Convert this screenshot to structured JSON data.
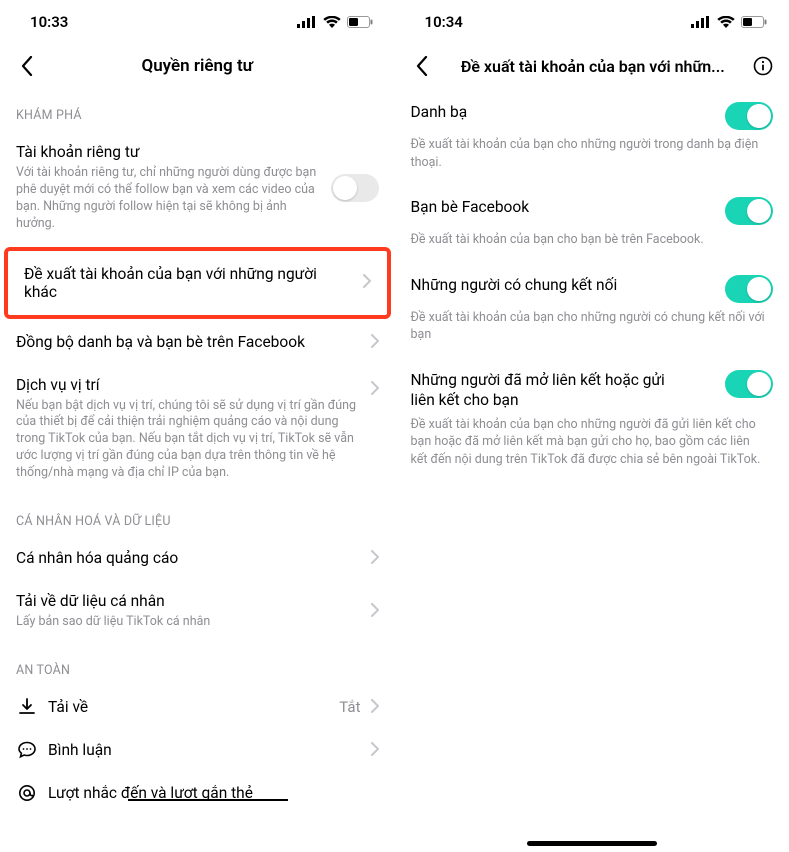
{
  "left": {
    "statusbar": {
      "time": "10:33"
    },
    "header": {
      "title": "Quyền riêng tư"
    },
    "sections": {
      "discover": {
        "title": "KHÁM PHÁ",
        "private_account": {
          "label": "Tài khoản riêng tư",
          "desc": "Với tài khoản riêng tư, chỉ những người dùng được bạn phê duyệt mới có thể follow bạn và xem các video của bạn. Những người follow hiện tại sẽ không bị ảnh hưởng.",
          "on": false
        },
        "suggest_account": {
          "label": "Đề xuất tài khoản của bạn với những người khác"
        },
        "sync_contacts": {
          "label": "Đồng bộ danh bạ và bạn bè trên Facebook"
        },
        "location": {
          "label": "Dịch vụ vị trí",
          "desc": "Nếu bạn bật dịch vụ vị trí, chúng tôi sẽ sử dụng vị trí gần đúng của thiết bị để cải thiện trải nghiệm quảng cáo và nội dung trong TikTok của bạn. Nếu bạn tắt dịch vụ vị trí, TikTok sẽ vẫn ước lượng vị trí gần đúng của bạn dựa trên thông tin về hệ thống/nhà mạng và địa chỉ IP của bạn."
        }
      },
      "personalization": {
        "title": "CÁ NHÂN HOÁ VÀ DỮ LIỆU",
        "ad_personalization": {
          "label": "Cá nhân hóa quảng cáo"
        },
        "download_data": {
          "label": "Tải về dữ liệu cá nhân",
          "desc": "Lấy bản sao dữ liệu TikTok cá nhân"
        }
      },
      "safety": {
        "title": "AN TOÀN",
        "downloads": {
          "label": "Tải về",
          "value": "Tắt"
        },
        "comments": {
          "label": "Bình luận"
        },
        "mentions": {
          "label": "Lượt nhắc đến và lượt gắn thẻ"
        }
      }
    }
  },
  "right": {
    "statusbar": {
      "time": "10:34"
    },
    "header": {
      "title": "Đề xuất tài khoản của bạn với nhữn..."
    },
    "items": {
      "contacts": {
        "label": "Danh bạ",
        "desc": "Đề xuất tài khoản của bạn cho những người trong danh bạ điện thoại.",
        "on": true
      },
      "facebook": {
        "label": "Bạn bè Facebook",
        "desc": "Đề xuất tài khoản của bạn cho bạn bè trên Facebook.",
        "on": true
      },
      "mutual": {
        "label": "Những người có chung kết nối",
        "desc": "Đề xuất tài khoản của bạn cho những người có chung kết nối với bạn",
        "on": true
      },
      "links": {
        "label": "Những người đã mở liên kết hoặc gửi liên kết cho bạn",
        "desc": "Đề xuất tài khoản của bạn cho những người đã gửi liên kết cho bạn hoặc đã mở liên kết mà bạn gửi cho họ, bao gồm các liên kết đến nội dung trên TikTok đã được chia sẻ bên ngoài TikTok.",
        "on": true
      }
    }
  }
}
